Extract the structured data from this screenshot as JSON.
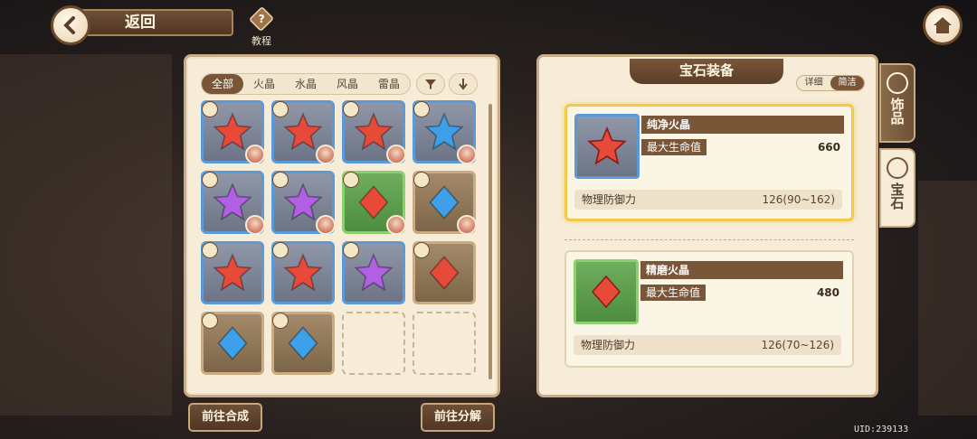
{
  "header": {
    "back_label": "返回",
    "help_label": "教程"
  },
  "filters": {
    "tabs": [
      "全部",
      "火晶",
      "水晶",
      "风晶",
      "雷晶"
    ],
    "active": 0
  },
  "grid": [
    {
      "color": "blue",
      "gem": "red-star",
      "avatar": true
    },
    {
      "color": "blue",
      "gem": "red-star",
      "avatar": true
    },
    {
      "color": "blue",
      "gem": "red-star",
      "avatar": true
    },
    {
      "color": "blue",
      "gem": "blue-star",
      "avatar": true
    },
    {
      "color": "blue",
      "gem": "purple-star",
      "avatar": true
    },
    {
      "color": "blue",
      "gem": "purple-star",
      "avatar": true
    },
    {
      "color": "green",
      "gem": "red-diamond",
      "avatar": true
    },
    {
      "color": "brown",
      "gem": "blue-diamond",
      "avatar": true
    },
    {
      "color": "blue",
      "gem": "red-star",
      "avatar": false
    },
    {
      "color": "blue",
      "gem": "red-star",
      "avatar": false
    },
    {
      "color": "blue",
      "gem": "purple-star",
      "avatar": false
    },
    {
      "color": "brown",
      "gem": "red-diamond",
      "avatar": false
    },
    {
      "color": "brown",
      "gem": "blue-diamond",
      "avatar": false
    },
    {
      "color": "brown",
      "gem": "blue-diamond",
      "avatar": false
    },
    {
      "color": "empty"
    },
    {
      "color": "empty"
    }
  ],
  "bottom_buttons": {
    "craft": "前往合成",
    "decompose": "前往分解"
  },
  "right_panel": {
    "title": "宝石装备",
    "view_toggle": [
      "详细",
      "简洁"
    ],
    "cards": [
      {
        "name": "纯净火晶",
        "stat_label": "最大生命值",
        "stat_value": "660",
        "sub_label": "物理防御力",
        "sub_value": "126(90~162)"
      },
      {
        "name": "精磨火晶",
        "stat_label": "最大生命值",
        "stat_value": "480",
        "sub_label": "物理防御力",
        "sub_value": "126(70~126)"
      }
    ]
  },
  "side_tabs": {
    "accessory": "饰品",
    "gem": "宝石"
  },
  "uid": "UID:239133",
  "colors": {
    "red": "#e84a3a",
    "blue": "#3ea0e8",
    "purple": "#b060e0"
  }
}
